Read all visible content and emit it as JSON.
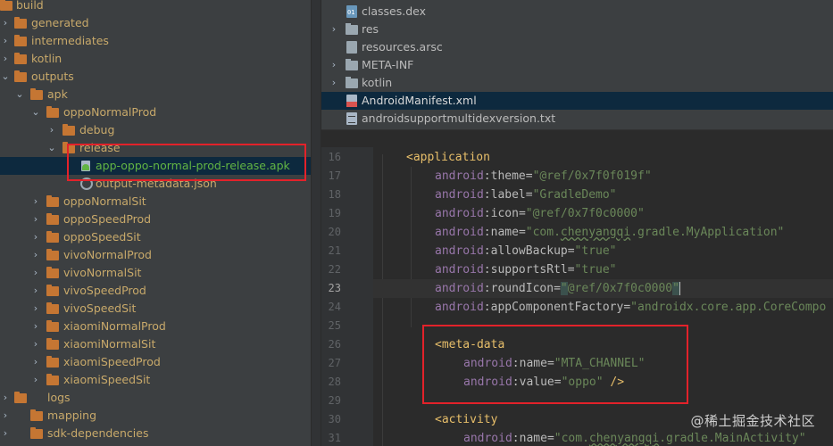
{
  "project_tree": {
    "items": [
      {
        "label": "build"
      },
      {
        "label": "generated"
      },
      {
        "label": "intermediates"
      },
      {
        "label": "kotlin"
      },
      {
        "label": "outputs"
      },
      {
        "label": "apk"
      },
      {
        "label": "oppoNormalProd"
      },
      {
        "label": "debug"
      },
      {
        "label": "release"
      },
      {
        "label": "app-oppo-normal-prod-release.apk"
      },
      {
        "label": "output-metadata.json"
      },
      {
        "label": "oppoNormalSit"
      },
      {
        "label": "oppoSpeedProd"
      },
      {
        "label": "oppoSpeedSit"
      },
      {
        "label": "vivoNormalProd"
      },
      {
        "label": "vivoNormalSit"
      },
      {
        "label": "vivoSpeedProd"
      },
      {
        "label": "vivoSpeedSit"
      },
      {
        "label": "xiaomiNormalProd"
      },
      {
        "label": "xiaomiNormalSit"
      },
      {
        "label": "xiaomiSpeedProd"
      },
      {
        "label": "xiaomiSpeedSit"
      },
      {
        "label": "logs"
      },
      {
        "label": "mapping"
      },
      {
        "label": "sdk-dependencies"
      }
    ]
  },
  "apk_contents": {
    "items": [
      {
        "label": "classes.dex"
      },
      {
        "label": "res"
      },
      {
        "label": "resources.arsc"
      },
      {
        "label": "META-INF"
      },
      {
        "label": "kotlin"
      },
      {
        "label": "AndroidManifest.xml"
      },
      {
        "label": "androidsupportmultidexversion.txt"
      }
    ]
  },
  "editor": {
    "line_numbers": [
      "16",
      "17",
      "18",
      "19",
      "20",
      "21",
      "22",
      "23",
      "24",
      "25",
      "26",
      "27",
      "28",
      "29",
      "30",
      "31"
    ],
    "current_line": "23",
    "tokens": {
      "application_tag": "<application",
      "meta_data_tag": "<meta-data",
      "activity_tag": "<activity",
      "ns": "android",
      "colon": ":",
      "eq": "=",
      "close_tag": " />",
      "theme_attr": "theme",
      "theme_val": "\"@ref/0x7f0f019f\"",
      "label_attr": "label",
      "label_val": "\"GradleDemo\"",
      "icon_attr": "icon",
      "icon_val": "\"@ref/0x7f0c0000\"",
      "name_attr": "name",
      "name_val_prefix": "\"com.",
      "name_val_chenyangqi": "chenyangqi",
      "name_val_suffix": ".gradle.MyApplication\"",
      "allowbackup_attr": "allowBackup",
      "allowbackup_val": "\"true\"",
      "supportsrtl_attr": "supportsRtl",
      "supportsrtl_val": "\"true\"",
      "roundicon_attr": "roundIcon",
      "quote": "\"",
      "roundicon_inner": "@ref/0x7f0c0000",
      "componentfactory_attr": "appComponentFactory",
      "componentfactory_val": "\"androidx.core.app.CoreCompo",
      "md_name_val": "\"MTA_CHANNEL\"",
      "value_attr": "value",
      "md_value_val": "\"oppo\"",
      "act_name_val_suffix": ".gradle.MainActivity\""
    }
  },
  "watermark": "@稀土掘金技术社区"
}
